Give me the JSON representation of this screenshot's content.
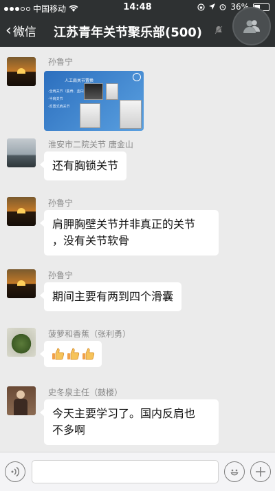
{
  "status_bar": {
    "carrier": "中国移动",
    "time": "14:48",
    "battery": "36%"
  },
  "nav": {
    "back_label": "微信",
    "title": "江苏青年关节聚乐部(500)"
  },
  "messages": [
    {
      "sender": "孙鲁宁",
      "type": "image",
      "image_text": {
        "title": "人工肩关节置换",
        "bullets": [
          "·全肩关节（肱骨、盂臼）",
          "·半肩关节",
          "·反置式肩关节"
        ]
      }
    },
    {
      "sender": "淮安市二院关节  唐金山",
      "type": "text",
      "text": "还有胸锁关节"
    },
    {
      "sender": "孙鲁宁",
      "type": "text",
      "lines": [
        "肩胛胸壁关节并非真正的关节",
        "，没有关节软骨"
      ]
    },
    {
      "sender": "孙鲁宁",
      "type": "text",
      "text": "期间主要有两到四个滑囊"
    },
    {
      "sender": "菠萝和香蕉（张利勇）",
      "type": "emoji",
      "emoji": [
        "thumbs-up",
        "thumbs-up",
        "thumbs-up"
      ]
    },
    {
      "sender": "史冬泉主任（鼓楼）",
      "type": "text",
      "lines": [
        "今天主要学习了。国内反肩也",
        "不多啊"
      ]
    }
  ],
  "colors": {
    "nav_bg": "#2e3132",
    "chat_bg": "#ebebeb",
    "bubble": "#ffffff"
  }
}
